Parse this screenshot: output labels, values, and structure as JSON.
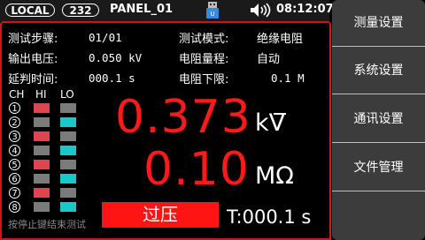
{
  "status_bar": {
    "mode": "LOCAL",
    "address": "232",
    "panel": "PANEL_01",
    "time": "08:12:07"
  },
  "info": {
    "step_label": "测试步骤:",
    "step_value": "01/01",
    "mode_label": "测试模式:",
    "mode_value": "绝缘电阻",
    "voltage_label": "输出电压:",
    "voltage_value": "0.050 kV",
    "range_label": "电阻量程:",
    "range_value": "自动",
    "delay_label": "延判时间:",
    "delay_value": "000.1 s",
    "lower_label": "电阻下限:",
    "lower_value": "0.1 M"
  },
  "channels": {
    "headers": [
      "CH",
      "HI",
      "LO"
    ],
    "rows": [
      {
        "num": "1",
        "hi": "red",
        "lo": "gray"
      },
      {
        "num": "2",
        "hi": "gray",
        "lo": "cyan"
      },
      {
        "num": "3",
        "hi": "red",
        "lo": "gray"
      },
      {
        "num": "4",
        "hi": "gray",
        "lo": "cyan"
      },
      {
        "num": "5",
        "hi": "red",
        "lo": "gray"
      },
      {
        "num": "6",
        "hi": "gray",
        "lo": "cyan"
      },
      {
        "num": "7",
        "hi": "red",
        "lo": "gray"
      },
      {
        "num": "8",
        "hi": "gray",
        "lo": "cyan"
      }
    ]
  },
  "readings": {
    "voltage": "0.373",
    "voltage_unit": "kV",
    "resistance": "0.10",
    "resistance_unit": "MΩ"
  },
  "result": {
    "status": "过压",
    "timer": "T:000.1 s",
    "hint": "按停止键结束测试"
  },
  "menu": {
    "items": [
      "测量设置",
      "系统设置",
      "通讯设置",
      "文件管理"
    ]
  },
  "colors": {
    "accent_red": "#ff1a1a",
    "frame_red": "#d0141b",
    "led_red": "#e0454d",
    "led_cyan": "#17c9c9",
    "led_gray": "#7b7b7b"
  }
}
